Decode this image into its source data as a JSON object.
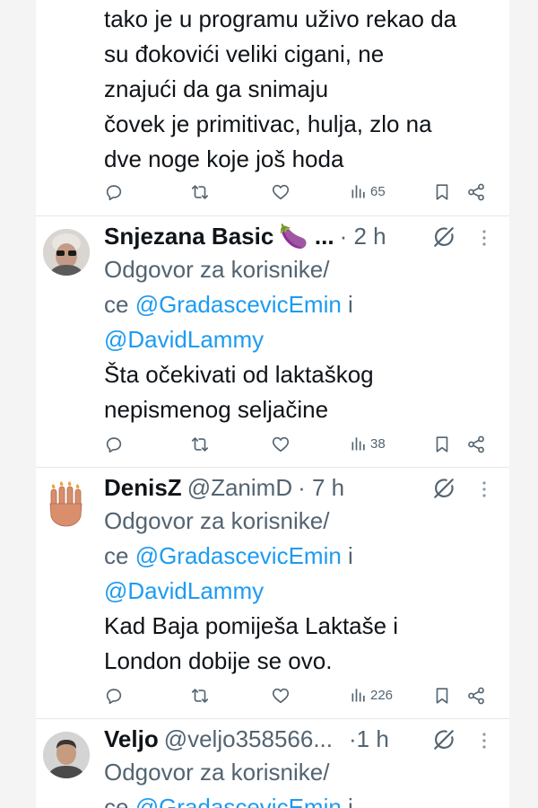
{
  "tweets": [
    {
      "text_lines": [
        "tako je u programu uživo rekao da",
        "su đokovići veliki cigani, ne",
        "znajući da ga snimaju",
        "čovek je primitivac, hulja, zlo na",
        "dve noge koje još hoda"
      ],
      "views": "65"
    },
    {
      "name": "Snjezana Basic",
      "name_suffix": "🍆 ...",
      "time": "· 2 h",
      "reply_line1": "Odgovor za korisnike/",
      "reply_prefix": "ce ",
      "mention1": "@GradascevicEmin",
      "reply_joiner": " i",
      "mention2": "@DavidLammy",
      "text_lines": [
        "Šta očekivati od laktaškog",
        "nepismenog seljačine"
      ],
      "views": "38"
    },
    {
      "name": "DenisZ",
      "handle": "@ZanimD",
      "time": "· 7 h",
      "reply_line1": "Odgovor za korisnike/",
      "reply_prefix": "ce ",
      "mention1": "@GradascevicEmin",
      "reply_joiner": " i",
      "mention2": "@DavidLammy",
      "text_lines": [
        "Kad Baja pomiješa Laktaše i",
        "London dobije se ovo."
      ],
      "views": "226"
    },
    {
      "name": "Veljo",
      "handle": "@veljo358566...",
      "time": "·1 h",
      "reply_line1": "Odgovor za korisnike/",
      "reply_prefix": "ce ",
      "mention1": "@GradascevicEmin",
      "reply_joiner": " i"
    }
  ],
  "icons": {
    "reply": "reply-icon",
    "retweet": "retweet-icon",
    "like": "heart-icon",
    "views": "views-icon",
    "bookmark": "bookmark-icon",
    "share": "share-icon",
    "grok": "grok-icon",
    "more": "more-icon"
  },
  "colors": {
    "text": "#0f1419",
    "muted": "#536471",
    "mention": "#1d9bf0",
    "background": "#ffffff"
  }
}
